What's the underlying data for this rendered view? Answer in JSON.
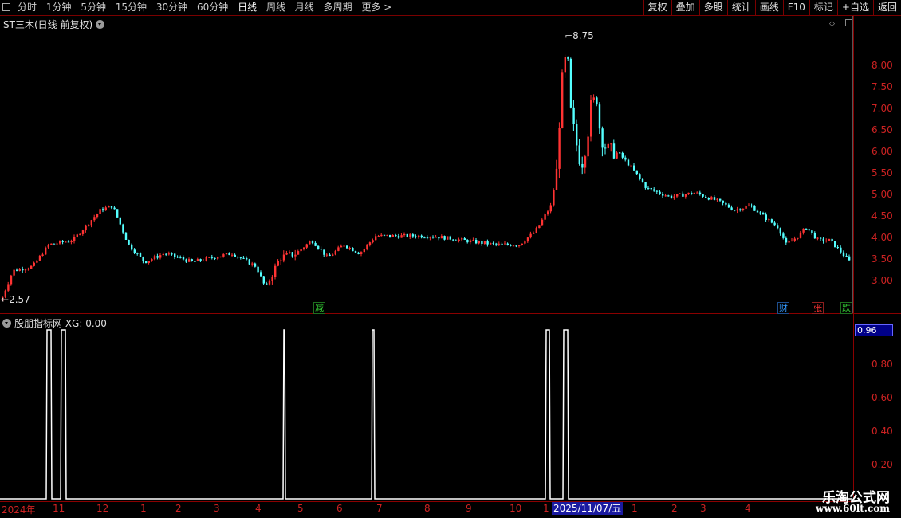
{
  "toolbar": {
    "periods": [
      "分时",
      "1分钟",
      "5分钟",
      "15分钟",
      "30分钟",
      "60分钟",
      "日线",
      "周线",
      "月线",
      "多周期",
      "更多 >"
    ],
    "active_period": "日线",
    "buttons": [
      "复权",
      "叠加",
      "多股",
      "统计",
      "画线",
      "F10",
      "标记",
      "+自选",
      "返回"
    ]
  },
  "main_chart": {
    "title": "ST三木(日线 前复权)",
    "high_label": "8.75",
    "low_label": "2.57",
    "price_ticks": [
      "8.00",
      "7.50",
      "7.00",
      "6.50",
      "6.00",
      "5.50",
      "5.00",
      "4.50",
      "4.00",
      "3.50",
      "3.00"
    ],
    "events": [
      {
        "text": "减",
        "color": "#33cc33"
      },
      {
        "text": "财",
        "color": "#3399ff"
      },
      {
        "text": "张",
        "color": "#ff3333"
      },
      {
        "text": "跌",
        "color": "#33cc33"
      }
    ]
  },
  "indicator": {
    "title": "股朋指标网 XG: 0.00",
    "current_value": "0.96",
    "ticks": [
      "0.80",
      "0.60",
      "0.40",
      "0.20"
    ]
  },
  "date_axis": {
    "labels": [
      "2024年",
      "11",
      "12",
      "1",
      "2",
      "3",
      "4",
      "5",
      "6",
      "7",
      "8",
      "9",
      "10",
      "1",
      "2025/11/07/五",
      "1",
      "2",
      "3",
      "4"
    ]
  },
  "watermark": {
    "line1": "乐淘公式网",
    "line2": "www.60lt.com"
  },
  "colors": {
    "up": "#ff3333",
    "down": "#54ffff",
    "background": "#000000",
    "border": "#8a0000",
    "axis_text": "#cc2222",
    "indicator_line": "#ffffff"
  }
}
